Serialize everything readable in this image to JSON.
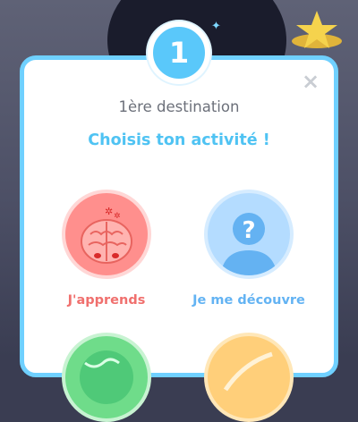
{
  "step_badge": "1",
  "modal": {
    "subtitle": "1ère destination",
    "title": "Choisis ton activité !",
    "close_symbol": "×"
  },
  "activities": [
    {
      "label": "J'apprends",
      "icon": "brain-icon",
      "color": "#ff8f8d"
    },
    {
      "label": "Je me découvre",
      "icon": "person-question-icon",
      "color": "#b4dcff"
    },
    {
      "label": "",
      "icon": "globe-icon",
      "color": "#6fdc8a"
    },
    {
      "label": "",
      "icon": "orange-activity-icon",
      "color": "#ffcf7a"
    }
  ],
  "colors": {
    "accent": "#5ac8fa",
    "title": "#4fc3f3",
    "border": "#6fd0ff"
  }
}
